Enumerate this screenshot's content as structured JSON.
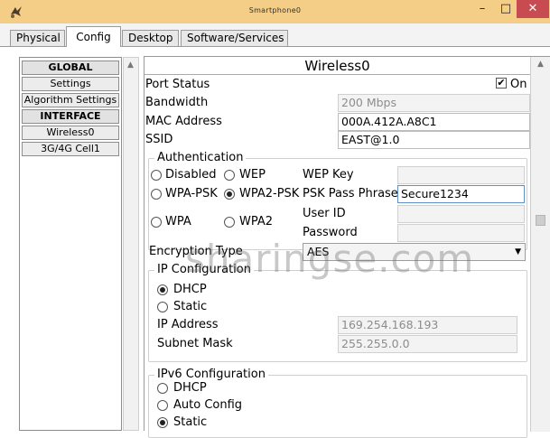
{
  "window": {
    "title": "Smartphone0",
    "min_glyph": "–",
    "max_glyph": "□",
    "close_glyph": "✕"
  },
  "tabs": [
    {
      "label": "Physical"
    },
    {
      "label": "Config"
    },
    {
      "label": "Desktop"
    },
    {
      "label": "Software/Services"
    }
  ],
  "sidebar": {
    "items": [
      {
        "label": "GLOBAL"
      },
      {
        "label": "Settings"
      },
      {
        "label": "Algorithm Settings"
      },
      {
        "label": "INTERFACE"
      },
      {
        "label": "Wireless0"
      },
      {
        "label": "3G/4G Cell1"
      }
    ]
  },
  "panel": {
    "title": "Wireless0",
    "port_status_label": "Port Status",
    "port_on_label": "On",
    "port_on_checked": "✔",
    "bandwidth_label": "Bandwidth",
    "bandwidth_value": "200 Mbps",
    "mac_label": "MAC Address",
    "mac_value": "000A.412A.A8C1",
    "ssid_label": "SSID",
    "ssid_value": "EAST@1.0"
  },
  "authentication": {
    "title": "Authentication",
    "options": [
      "Disabled",
      "WEP",
      "WPA-PSK",
      "WPA2-PSK",
      "WPA",
      "WPA2"
    ],
    "selected": "WPA2-PSK",
    "wep_key_label": "WEP Key",
    "psk_label": "PSK Pass Phrase",
    "psk_value": "Secure1234",
    "user_id_label": "User ID",
    "password_label": "Password"
  },
  "encryption": {
    "label": "Encryption Type",
    "value": "AES",
    "caret": "▼"
  },
  "ip_config": {
    "title": "IP Configuration",
    "dhcp_label": "DHCP",
    "static_label": "Static",
    "selected": "DHCP",
    "ip_label": "IP Address",
    "ip_value": "169.254.168.193",
    "mask_label": "Subnet Mask",
    "mask_value": "255.255.0.0"
  },
  "ipv6_config": {
    "title": "IPv6 Configuration",
    "dhcp_label": "DHCP",
    "auto_label": "Auto Config",
    "static_label": "Static",
    "selected": "Static"
  },
  "watermark": "sharingse.com",
  "colors": {
    "titlebar": "#f4cd86",
    "close_button": "#c74b50",
    "focus_border": "#5f8fcb"
  }
}
